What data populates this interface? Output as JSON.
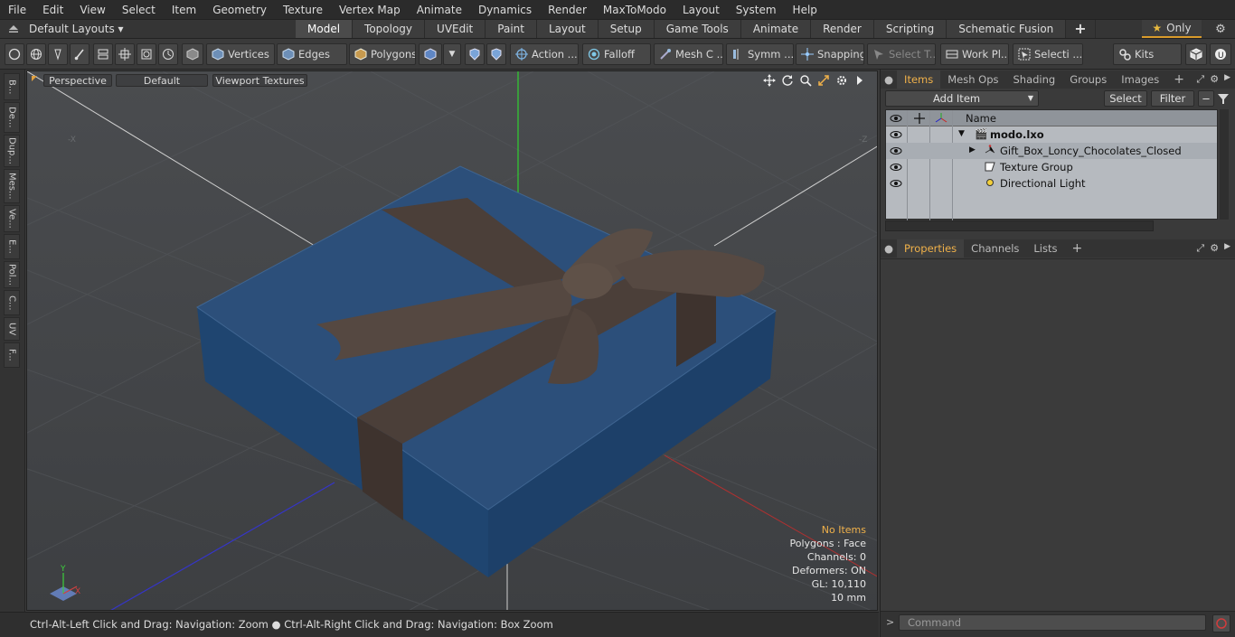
{
  "menu": [
    "File",
    "Edit",
    "View",
    "Select",
    "Item",
    "Geometry",
    "Texture",
    "Vertex Map",
    "Animate",
    "Dynamics",
    "Render",
    "MaxToModo",
    "Layout",
    "System",
    "Help"
  ],
  "layout": {
    "selector": "Default Layouts ▾",
    "tabs": [
      "Model",
      "Topology",
      "UVEdit",
      "Paint",
      "Layout",
      "Setup",
      "Game Tools",
      "Animate",
      "Render",
      "Scripting",
      "Schematic Fusion"
    ],
    "active_tab": "Model",
    "only_label": "Only"
  },
  "toolbar": {
    "vertices": "Vertices",
    "edges": "Edges",
    "polygons": "Polygons",
    "action": "Action ...",
    "falloff": "Falloff",
    "mesh": "Mesh C ...",
    "symmetry": "Symm ...",
    "snapping": "Snapping",
    "select_t": "Select T...",
    "work_plane": "Work Pl...",
    "selection": "Selecti ...",
    "kits": "Kits"
  },
  "left_tabs": [
    "B...",
    "De...",
    "Dup...",
    "Mes...",
    "Ve...",
    "E...",
    "Pol...",
    "C...",
    "UV",
    "F..."
  ],
  "viewport": {
    "view_mode": "Perspective",
    "shading": "Default",
    "textures": "Viewport Textures",
    "hud": {
      "selection": "No Items",
      "polygons": "Polygons : Face",
      "channels": "Channels: 0",
      "deformers": "Deformers: ON",
      "gl": "GL: 10,110",
      "unit": "10 mm"
    },
    "axis_labels": {
      "y": "Y",
      "x": "X"
    }
  },
  "status": "Ctrl-Alt-Left Click and Drag: Navigation: Zoom ● Ctrl-Alt-Right Click and Drag: Navigation: Box Zoom",
  "items_panel": {
    "tabs": [
      "Items",
      "Mesh Ops",
      "Shading",
      "Groups",
      "Images"
    ],
    "active_tab": "Items",
    "add_item": "Add Item",
    "select": "Select",
    "filter": "Filter",
    "column_name": "Name",
    "rows": [
      {
        "name": "modo.lxo",
        "icon": "scene-icon"
      },
      {
        "name": "Gift_Box_Loncy_Chocolates_Closed",
        "icon": "mesh-icon"
      },
      {
        "name": "Texture Group",
        "icon": "texture-group-icon"
      },
      {
        "name": "Directional Light",
        "icon": "light-icon"
      }
    ]
  },
  "properties_panel": {
    "tabs": [
      "Properties",
      "Channels",
      "Lists"
    ],
    "active_tab": "Properties"
  },
  "command": {
    "placeholder": "Command"
  },
  "colors": {
    "accent": "#f0b14a",
    "box_blue": "#2a4a6e",
    "ribbon": "#4a3f38"
  }
}
